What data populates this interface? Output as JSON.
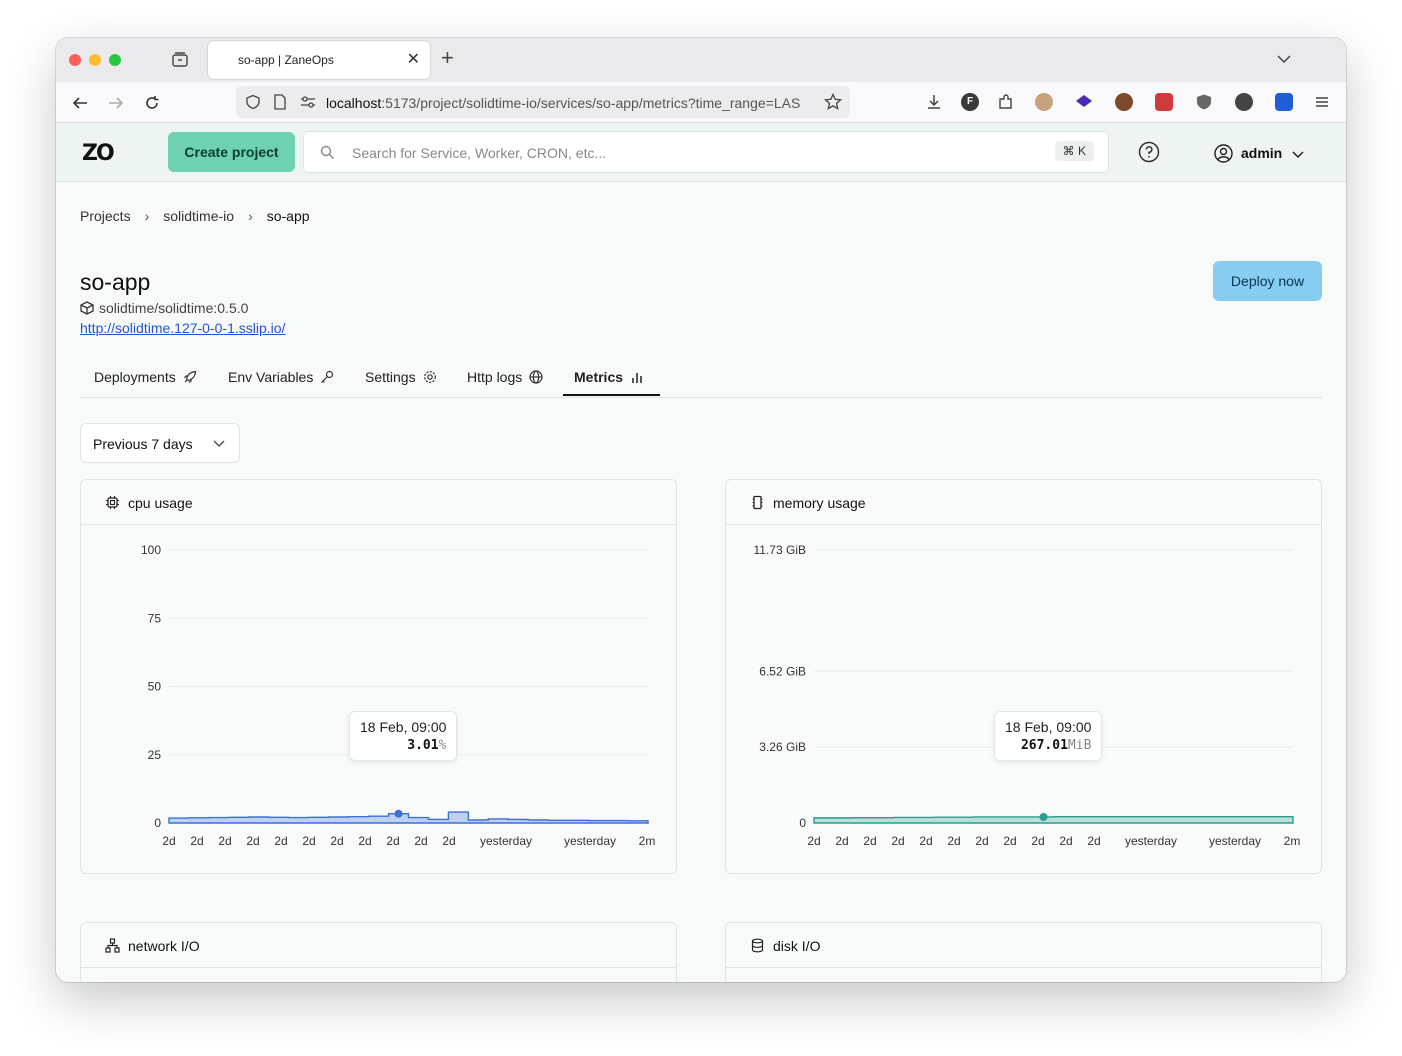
{
  "browser": {
    "tab_title": "so-app | ZaneOps",
    "url_host": "localhost",
    "url_path": ":5173/project/solidtime-io/services/so-app/metrics?time_range=LAS"
  },
  "header": {
    "logo": "ZO",
    "create_label": "Create project",
    "search_placeholder": "Search for Service, Worker, CRON, etc...",
    "search_shortcut": "⌘ K",
    "user_name": "admin"
  },
  "breadcrumb": {
    "items": [
      "Projects",
      "solidtime-io",
      "so-app"
    ]
  },
  "service": {
    "title": "so-app",
    "image": "solidtime/solidtime:0.5.0",
    "url": "http://solidtime.127-0-0-1.sslip.io/",
    "deploy_label": "Deploy now"
  },
  "tabs": [
    {
      "label": "Deployments",
      "icon": "rocket-icon"
    },
    {
      "label": "Env Variables",
      "icon": "key-icon"
    },
    {
      "label": "Settings",
      "icon": "gear-icon"
    },
    {
      "label": "Http logs",
      "icon": "globe-icon"
    },
    {
      "label": "Metrics",
      "icon": "bar-chart-icon",
      "active": true
    }
  ],
  "time_range": {
    "selected": "Previous 7 days"
  },
  "cards": {
    "cpu": {
      "title": "cpu usage",
      "icon": "cpu-icon"
    },
    "memory": {
      "title": "memory usage",
      "icon": "memory-icon"
    },
    "network": {
      "title": "network I/O",
      "icon": "network-icon"
    },
    "disk": {
      "title": "disk I/O",
      "icon": "database-icon"
    }
  },
  "colors": {
    "cpu": "#3b6fd8",
    "memory": "#2a9d8f",
    "accent": "#6fd1b3",
    "deploy": "#86cdf1"
  },
  "chart_data": [
    {
      "type": "area",
      "title": "cpu usage",
      "x_tick_labels": [
        "2d",
        "2d",
        "2d",
        "2d",
        "2d",
        "2d",
        "2d",
        "2d",
        "2d",
        "2d",
        "2d",
        "yesterday",
        "yesterday",
        "2m"
      ],
      "y_ticks": [
        "0",
        "25",
        "50",
        "75",
        "100"
      ],
      "ylim": [
        0,
        100
      ],
      "values": [
        1.8,
        1.9,
        2.0,
        2.1,
        2.2,
        2.1,
        2.0,
        2.1,
        2.2,
        2.3,
        2.5,
        3.4,
        2.0,
        1.3,
        4.0,
        1.1,
        1.5,
        1.3,
        1.1,
        1.0,
        1.0,
        0.9,
        0.9,
        0.8
      ],
      "tooltip": {
        "date": "18 Feb, 09:00",
        "value": "3.01",
        "unit": "%"
      }
    },
    {
      "type": "area",
      "title": "memory usage",
      "x_tick_labels": [
        "2d",
        "2d",
        "2d",
        "2d",
        "2d",
        "2d",
        "2d",
        "2d",
        "2d",
        "2d",
        "2d",
        "yesterday",
        "yesterday",
        "2m"
      ],
      "y_ticks": [
        "0",
        "3.26 GiB",
        "6.52 GiB",
        "11.73 GiB"
      ],
      "y_tick_values": [
        0,
        3.26,
        6.52,
        11.73
      ],
      "ylim": [
        0,
        11.73
      ],
      "values": [
        0.22,
        0.22,
        0.23,
        0.23,
        0.24,
        0.24,
        0.25,
        0.25,
        0.26,
        0.26,
        0.26,
        0.26,
        0.27,
        0.27,
        0.27,
        0.27,
        0.27,
        0.27,
        0.27,
        0.27,
        0.27,
        0.27,
        0.27,
        0.27
      ],
      "tooltip": {
        "date": "18 Feb, 09:00",
        "value": "267.01",
        "unit": "MiB"
      }
    }
  ]
}
